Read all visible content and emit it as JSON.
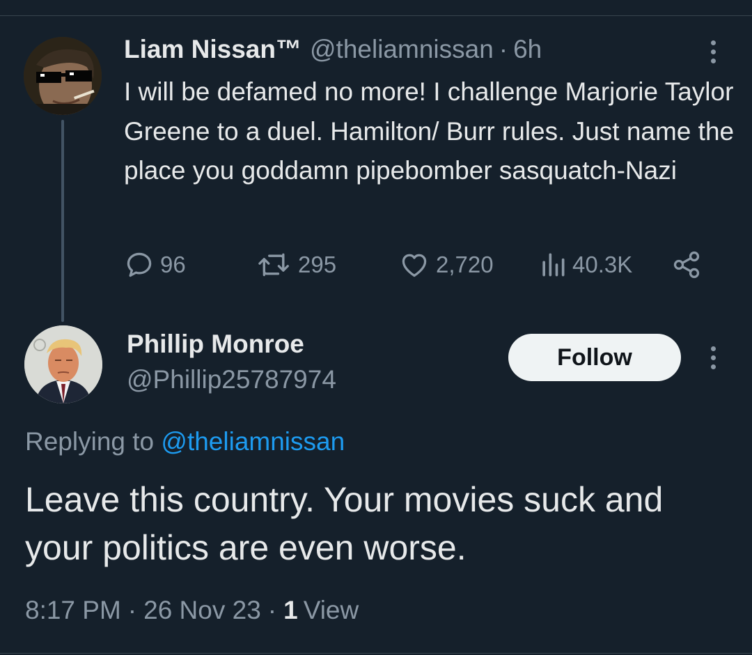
{
  "parent_tweet": {
    "display_name": "Liam Nissan™",
    "handle": "@theliamnissan",
    "separator": "·",
    "time": "6h",
    "text": "I will be defamed no more! I challenge Marjorie Taylor Greene to a duel. Hamilton/ Burr rules. Just name the place you goddamn pipebomber sasquatch-Nazi",
    "actions": {
      "replies": "96",
      "retweets": "295",
      "likes": "2,720",
      "views": "40.3K"
    },
    "icons": [
      "reply-icon",
      "retweet-icon",
      "like-icon",
      "views-icon",
      "share-icon",
      "more-icon"
    ]
  },
  "reply_tweet": {
    "display_name": "Phillip Monroe",
    "handle": "@Phillip25787974",
    "follow_label": "Follow",
    "replying_prefix": "Replying to",
    "replying_mention": "@theliamnissan",
    "text": "Leave this country. Your movies suck and your politics are even worse.",
    "time": "8:17 PM",
    "separator": "·",
    "date": "26 Nov 23",
    "view_count": "1",
    "view_label": "View"
  },
  "colors": {
    "background": "#15202b",
    "primary_text": "#e7e9ea",
    "secondary_text": "#8b98a5",
    "accent": "#1d9bf0",
    "follow_button": "#eff3f4"
  }
}
